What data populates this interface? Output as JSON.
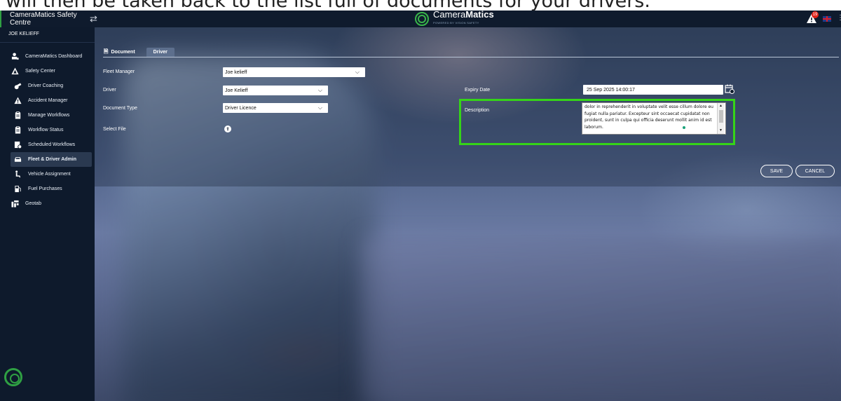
{
  "caption": {
    "text": "will then be taken back to the list full of documents for your drivers."
  },
  "app": {
    "title": "CameraMatics Safety Centre",
    "swap_glyph": "⇄",
    "brand_light": "Camera",
    "brand_bold": "Matics",
    "brand_sub": "POWERED BY VISION SAFETY",
    "alert_count": "19",
    "user_name": "JOE KELIEFF"
  },
  "sidebar": {
    "items": [
      {
        "label": "CameraMatics Dashboard",
        "icon": "dashboard-icon",
        "level": 1
      },
      {
        "label": "Safety Center",
        "icon": "warning-triangle-icon",
        "level": 1
      },
      {
        "label": "Driver Coaching",
        "icon": "whistle-icon",
        "level": 2
      },
      {
        "label": "Accident Manager",
        "icon": "alert-triangle-icon",
        "level": 2
      },
      {
        "label": "Manage Workflows",
        "icon": "clipboard-icon",
        "level": 2
      },
      {
        "label": "Workflow Status",
        "icon": "clipboard-icon",
        "level": 2
      },
      {
        "label": "Scheduled Workflows",
        "icon": "schedule-icon",
        "level": 2
      },
      {
        "label": "Fleet & Driver Admin",
        "icon": "car-icon",
        "level": 2,
        "active": true
      },
      {
        "label": "Vehicle Assignment",
        "icon": "person-seat-icon",
        "level": 2
      },
      {
        "label": "Fuel Purchases",
        "icon": "fuel-icon",
        "level": 2
      },
      {
        "label": "Geotab",
        "icon": "geotab-icon",
        "level": 1
      }
    ]
  },
  "tabs": {
    "document": "Document",
    "driver": "Driver"
  },
  "form": {
    "fleet_manager_label": "Fleet Manager",
    "fleet_manager_value": "Joe kelieff",
    "driver_label": "Driver",
    "driver_value": "Joe Kelieff",
    "document_type_label": "Document Type",
    "document_type_value": "Driver Licence",
    "select_file_label": "Select File",
    "expiry_date_label": "Expiry Date",
    "expiry_date_value": "25 Sep 2025 14:00:17",
    "description_label": "Description",
    "description_value": "dolor in reprehenderit in voluptate velit esse cillum dolore eu fugiat nulla pariatur. Excepteur sint occaecat cupidatat non proident, sunt in culpa qui officia deserunt mollit anim id est laborum."
  },
  "buttons": {
    "save": "SAVE",
    "cancel": "CANCEL"
  },
  "colors": {
    "highlight": "#35d418",
    "sidebar_bg": "#0e1a2c",
    "brand_green": "#2fa043"
  }
}
